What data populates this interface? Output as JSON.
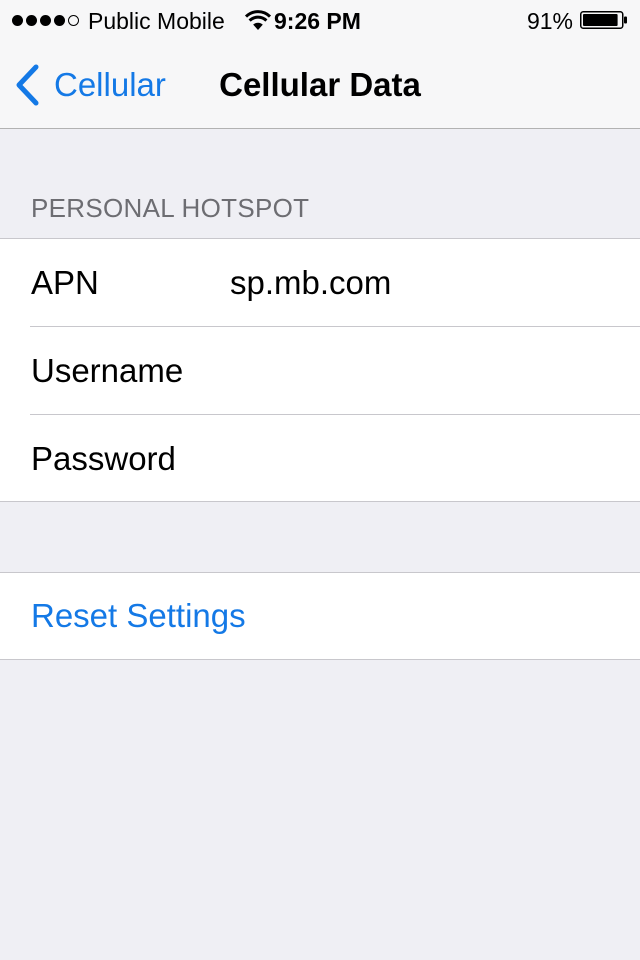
{
  "status_bar": {
    "signal_bars_filled": 4,
    "signal_bars_total": 5,
    "carrier": "Public Mobile",
    "wifi_icon": "wifi-icon",
    "time": "9:26 PM",
    "battery_percent": "91%",
    "battery_level": 0.91,
    "battery_icon": "battery-icon"
  },
  "nav": {
    "back_label": "Cellular",
    "back_icon": "chevron-left-icon",
    "title": "Cellular Data"
  },
  "hotspot": {
    "section_title": "PERSONAL HOTSPOT",
    "fields": [
      {
        "label": "APN",
        "value": "sp.mb.com"
      },
      {
        "label": "Username",
        "value": ""
      },
      {
        "label": "Password",
        "value": ""
      }
    ]
  },
  "reset": {
    "label": "Reset Settings"
  },
  "colors": {
    "accent": "#1479e6",
    "background": "#efeff4",
    "separator": "#c8c7cc",
    "section_header": "#6d6d72"
  }
}
